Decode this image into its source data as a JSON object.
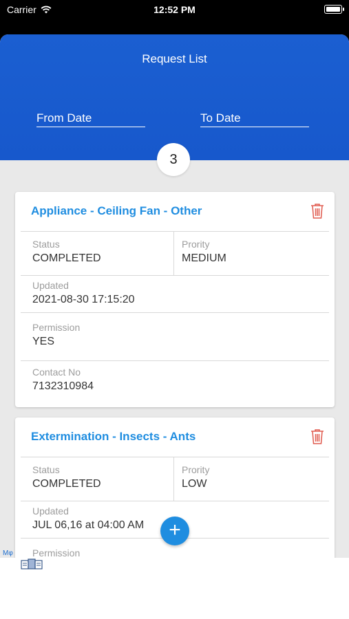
{
  "status_bar": {
    "carrier": "Carrier",
    "time": "12:52 PM"
  },
  "header": {
    "title": "Request List",
    "from_date_label": "From Date",
    "to_date_label": "To Date",
    "count": "3"
  },
  "cards": [
    {
      "title": "Appliance - Ceiling Fan - Other",
      "status_label": "Status",
      "status_value": "COMPLETED",
      "priority_label": "Prority",
      "priority_value": "MEDIUM",
      "updated_label": "Updated",
      "updated_value": "2021-08-30 17:15:20",
      "permission_label": "Permission",
      "permission_value": "YES",
      "contact_label": "Contact No",
      "contact_value": "7132310984"
    },
    {
      "title": "Extermination - Insects - Ants",
      "status_label": "Status",
      "status_value": "COMPLETED",
      "priority_label": "Prority",
      "priority_value": "LOW",
      "updated_label": "Updated",
      "updated_value": "JUL 06,16 at 04:00 AM",
      "permission_label": "Permission"
    }
  ],
  "fab_label": "+",
  "ad": {
    "tag": "Mφ"
  },
  "colors": {
    "header_blue": "#1b5fd1",
    "title_blue": "#1f8de0",
    "trash_red": "#e05a4e"
  }
}
